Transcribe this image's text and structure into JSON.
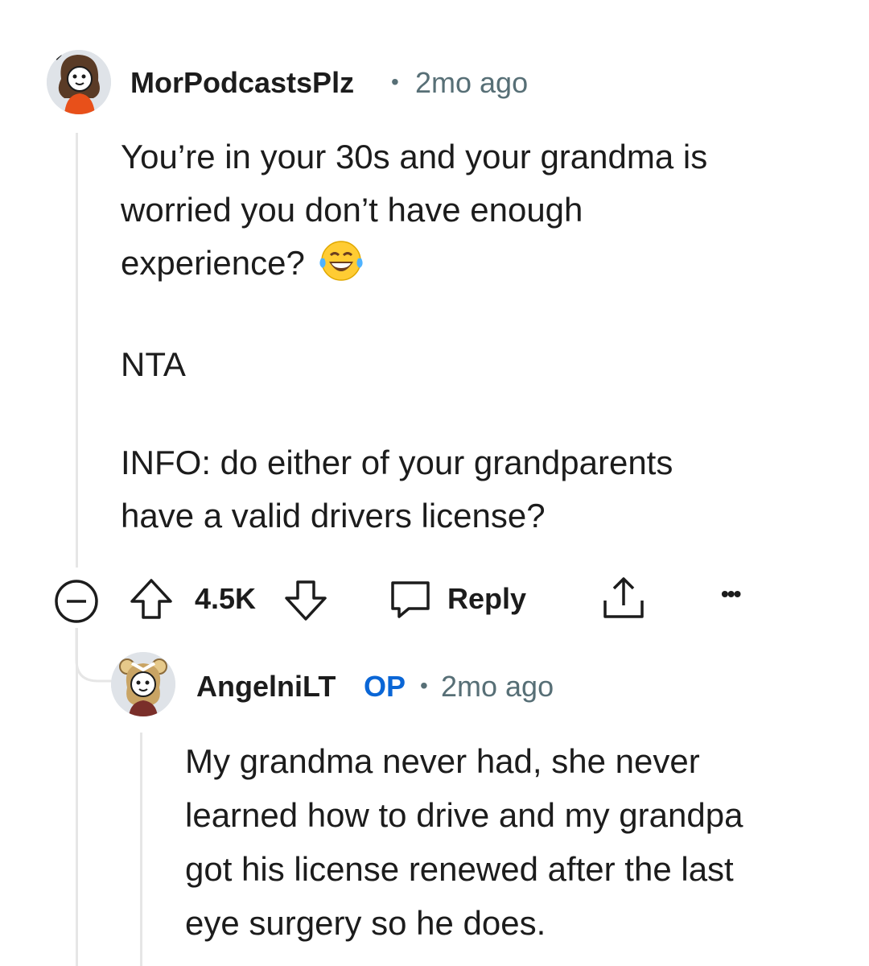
{
  "comment": {
    "username": "MorPodcastsPlz",
    "separator": "•",
    "age": "2mo ago",
    "lines": [
      "You’re in your 30s and your grandma is",
      "worried you don’t have enough",
      "experience?"
    ],
    "emoji": "😂",
    "verdict": "NTA",
    "info_lines": [
      "INFO: do either of your grandparents",
      "have a valid drivers license?"
    ],
    "actions": {
      "collapse_icon": "collapse-minus-icon",
      "upvote_icon": "upvote-arrow-icon",
      "score": "4.5K",
      "downvote_icon": "downvote-arrow-icon",
      "reply_icon": "reply-bubble-icon",
      "reply_label": "Reply",
      "share_icon": "share-icon",
      "more_icon": "more-options-icon",
      "more_label": "•••"
    }
  },
  "reply": {
    "username": "AngelniLT",
    "op_badge": "OP",
    "separator": "•",
    "age": "2mo ago",
    "lines": [
      "My grandma never had, she never",
      "learned how to drive and my grandpa",
      "got his license renewed after the last",
      "eye surgery so he does."
    ]
  },
  "colors": {
    "text": "#1c1c1c",
    "meta": "#576f76",
    "op": "#0a66d6",
    "thread_line": "#e6e6e6"
  }
}
